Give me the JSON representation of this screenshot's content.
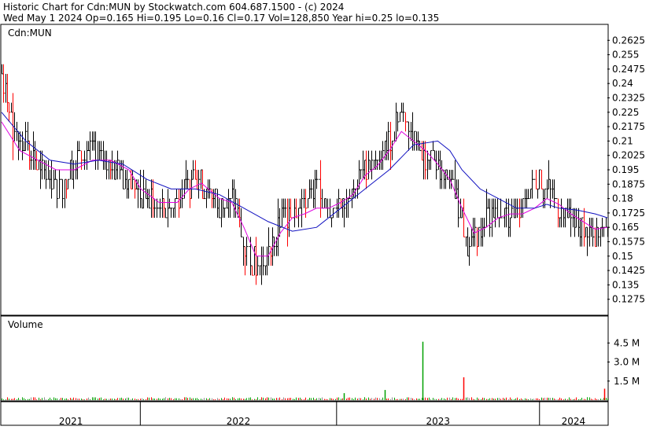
{
  "header": {
    "line1": "Historic Chart for Cdn:MUN by Stockwatch.com 604.687.1500 - (c) 2024",
    "line2": "Wed May  1 2024   Op=0.165  Hi=0.195  Lo=0.16  Cl=0.17  Vol=128,850   Year hi=0.25  lo=0.135"
  },
  "colors": {
    "price_bar": "#000000",
    "price_bar_down": "#ff0000",
    "ma_short": "#e000e0",
    "ma_long": "#1010c0",
    "volume_up": "#00a000",
    "volume_down": "#ff0000",
    "volume_neutral": "#909090",
    "frame": "#000000"
  },
  "chart_data": [
    {
      "type": "line",
      "panel": "price",
      "title": "Cdn:MUN",
      "ylim": [
        0.12,
        0.27
      ],
      "y_ticks": [
        "0.2625",
        "0.255",
        "0.2475",
        "0.24",
        "0.2325",
        "0.225",
        "0.2175",
        "0.21",
        "0.2025",
        "0.195",
        "0.1875",
        "0.18",
        "0.1725",
        "0.165",
        "0.1575",
        "0.15",
        "0.1425",
        "0.135",
        "0.1275"
      ],
      "y_tick_values": [
        0.2625,
        0.255,
        0.2475,
        0.24,
        0.2325,
        0.225,
        0.2175,
        0.21,
        0.2025,
        0.195,
        0.1875,
        0.18,
        0.1725,
        0.165,
        0.1575,
        0.15,
        0.1425,
        0.135,
        0.1275
      ],
      "x_ticks": [
        "2021",
        "2022",
        "2023",
        "2024"
      ],
      "x_tick_fraction": [
        0.0,
        0.229,
        0.553,
        0.888
      ],
      "grid": false,
      "series": [
        {
          "kind": "price",
          "points": [
            [
              0.0,
              0.245
            ],
            [
              0.02,
              0.215
            ],
            [
              0.04,
              0.21
            ],
            [
              0.06,
              0.195
            ],
            [
              0.08,
              0.19
            ],
            [
              0.1,
              0.185
            ],
            [
              0.12,
              0.2
            ],
            [
              0.14,
              0.205
            ],
            [
              0.16,
              0.2
            ],
            [
              0.18,
              0.2
            ],
            [
              0.2,
              0.19
            ],
            [
              0.22,
              0.185
            ],
            [
              0.24,
              0.18
            ],
            [
              0.26,
              0.175
            ],
            [
              0.28,
              0.175
            ],
            [
              0.3,
              0.185
            ],
            [
              0.32,
              0.19
            ],
            [
              0.34,
              0.185
            ],
            [
              0.36,
              0.175
            ],
            [
              0.38,
              0.18
            ],
            [
              0.39,
              0.17
            ],
            [
              0.4,
              0.155
            ],
            [
              0.42,
              0.145
            ],
            [
              0.44,
              0.15
            ],
            [
              0.46,
              0.17
            ],
            [
              0.48,
              0.175
            ],
            [
              0.5,
              0.18
            ],
            [
              0.52,
              0.185
            ],
            [
              0.54,
              0.17
            ],
            [
              0.56,
              0.18
            ],
            [
              0.58,
              0.185
            ],
            [
              0.6,
              0.195
            ],
            [
              0.62,
              0.2
            ],
            [
              0.64,
              0.21
            ],
            [
              0.655,
              0.225
            ],
            [
              0.67,
              0.22
            ],
            [
              0.69,
              0.205
            ],
            [
              0.71,
              0.2
            ],
            [
              0.73,
              0.195
            ],
            [
              0.75,
              0.18
            ],
            [
              0.77,
              0.155
            ],
            [
              0.78,
              0.16
            ],
            [
              0.8,
              0.17
            ],
            [
              0.82,
              0.175
            ],
            [
              0.84,
              0.17
            ],
            [
              0.86,
              0.175
            ],
            [
              0.88,
              0.19
            ],
            [
              0.9,
              0.185
            ],
            [
              0.92,
              0.175
            ],
            [
              0.94,
              0.17
            ],
            [
              0.96,
              0.165
            ],
            [
              0.98,
              0.16
            ],
            [
              1.0,
              0.17
            ]
          ]
        },
        {
          "kind": "ma_short",
          "points": [
            [
              0.0,
              0.22
            ],
            [
              0.03,
              0.205
            ],
            [
              0.06,
              0.2
            ],
            [
              0.09,
              0.195
            ],
            [
              0.12,
              0.195
            ],
            [
              0.15,
              0.2
            ],
            [
              0.18,
              0.2
            ],
            [
              0.21,
              0.195
            ],
            [
              0.23,
              0.185
            ],
            [
              0.26,
              0.178
            ],
            [
              0.29,
              0.178
            ],
            [
              0.31,
              0.185
            ],
            [
              0.33,
              0.188
            ],
            [
              0.36,
              0.18
            ],
            [
              0.38,
              0.178
            ],
            [
              0.4,
              0.165
            ],
            [
              0.42,
              0.15
            ],
            [
              0.44,
              0.15
            ],
            [
              0.46,
              0.162
            ],
            [
              0.48,
              0.17
            ],
            [
              0.5,
              0.172
            ],
            [
              0.52,
              0.175
            ],
            [
              0.54,
              0.175
            ],
            [
              0.56,
              0.178
            ],
            [
              0.58,
              0.182
            ],
            [
              0.6,
              0.192
            ],
            [
              0.62,
              0.197
            ],
            [
              0.64,
              0.205
            ],
            [
              0.66,
              0.215
            ],
            [
              0.68,
              0.21
            ],
            [
              0.7,
              0.205
            ],
            [
              0.72,
              0.198
            ],
            [
              0.74,
              0.19
            ],
            [
              0.76,
              0.175
            ],
            [
              0.78,
              0.162
            ],
            [
              0.8,
              0.165
            ],
            [
              0.82,
              0.17
            ],
            [
              0.84,
              0.172
            ],
            [
              0.86,
              0.172
            ],
            [
              0.88,
              0.175
            ],
            [
              0.9,
              0.18
            ],
            [
              0.92,
              0.177
            ],
            [
              0.94,
              0.172
            ],
            [
              0.96,
              0.168
            ],
            [
              0.98,
              0.164
            ],
            [
              1.0,
              0.165
            ]
          ]
        },
        {
          "kind": "ma_long",
          "points": [
            [
              0.0,
              0.225
            ],
            [
              0.04,
              0.21
            ],
            [
              0.08,
              0.2
            ],
            [
              0.12,
              0.198
            ],
            [
              0.16,
              0.2
            ],
            [
              0.2,
              0.198
            ],
            [
              0.24,
              0.19
            ],
            [
              0.28,
              0.185
            ],
            [
              0.32,
              0.185
            ],
            [
              0.36,
              0.182
            ],
            [
              0.4,
              0.175
            ],
            [
              0.44,
              0.168
            ],
            [
              0.48,
              0.163
            ],
            [
              0.52,
              0.165
            ],
            [
              0.56,
              0.175
            ],
            [
              0.6,
              0.185
            ],
            [
              0.64,
              0.195
            ],
            [
              0.68,
              0.208
            ],
            [
              0.72,
              0.21
            ],
            [
              0.74,
              0.205
            ],
            [
              0.76,
              0.195
            ],
            [
              0.79,
              0.185
            ],
            [
              0.82,
              0.18
            ],
            [
              0.85,
              0.175
            ],
            [
              0.88,
              0.175
            ],
            [
              0.9,
              0.177
            ],
            [
              0.92,
              0.175
            ],
            [
              0.95,
              0.174
            ],
            [
              0.98,
              0.172
            ],
            [
              1.0,
              0.17
            ]
          ]
        }
      ]
    },
    {
      "type": "bar",
      "panel": "volume",
      "title": "Volume",
      "ylim": [
        0,
        6.5
      ],
      "y_ticks": [
        "4.5 M",
        "3.0 M",
        "1.5 M"
      ],
      "y_tick_values": [
        4.5,
        3.0,
        1.5
      ],
      "unit": "M",
      "spikes": [
        {
          "x": 0.695,
          "value": 4.6,
          "color": "up"
        },
        {
          "x": 0.762,
          "value": 1.8,
          "color": "down"
        },
        {
          "x": 0.995,
          "value": 0.9,
          "color": "down"
        },
        {
          "x": 0.633,
          "value": 0.8,
          "color": "up"
        },
        {
          "x": 0.565,
          "value": 0.55,
          "color": "up"
        }
      ]
    }
  ]
}
